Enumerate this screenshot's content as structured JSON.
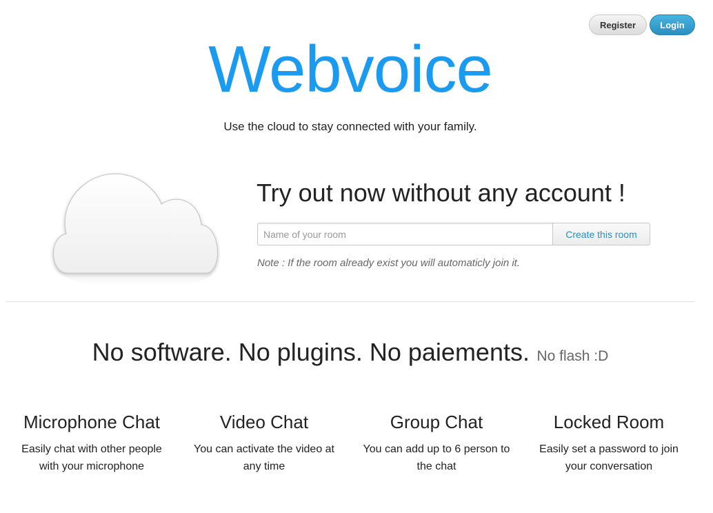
{
  "header": {
    "register_label": "Register",
    "login_label": "Login",
    "brand": "Webvoice",
    "tagline": "Use the cloud to stay connected with your family."
  },
  "tryout": {
    "title": "Try out now without any account !",
    "room_placeholder": "Name of your room",
    "room_value": "",
    "create_label": "Create this room",
    "note": "Note : If the room already exist you will automaticly join it."
  },
  "hero_icon": "cloud-icon",
  "headline": {
    "main": "No software. No plugins. No paiements.",
    "small": "No flash :D"
  },
  "features": [
    {
      "title": "Microphone Chat",
      "description": "Easily chat with other people with your microphone"
    },
    {
      "title": "Video Chat",
      "description": "You can activate the video at any time"
    },
    {
      "title": "Group Chat",
      "description": "You can add up to 6 person to the chat"
    },
    {
      "title": "Locked Room",
      "description": "Easily set a password to join your conversation"
    }
  ],
  "colors": {
    "brand": "#1a9bf0",
    "login_button": "#2a8fc0",
    "text": "#222222",
    "muted": "#666666"
  }
}
